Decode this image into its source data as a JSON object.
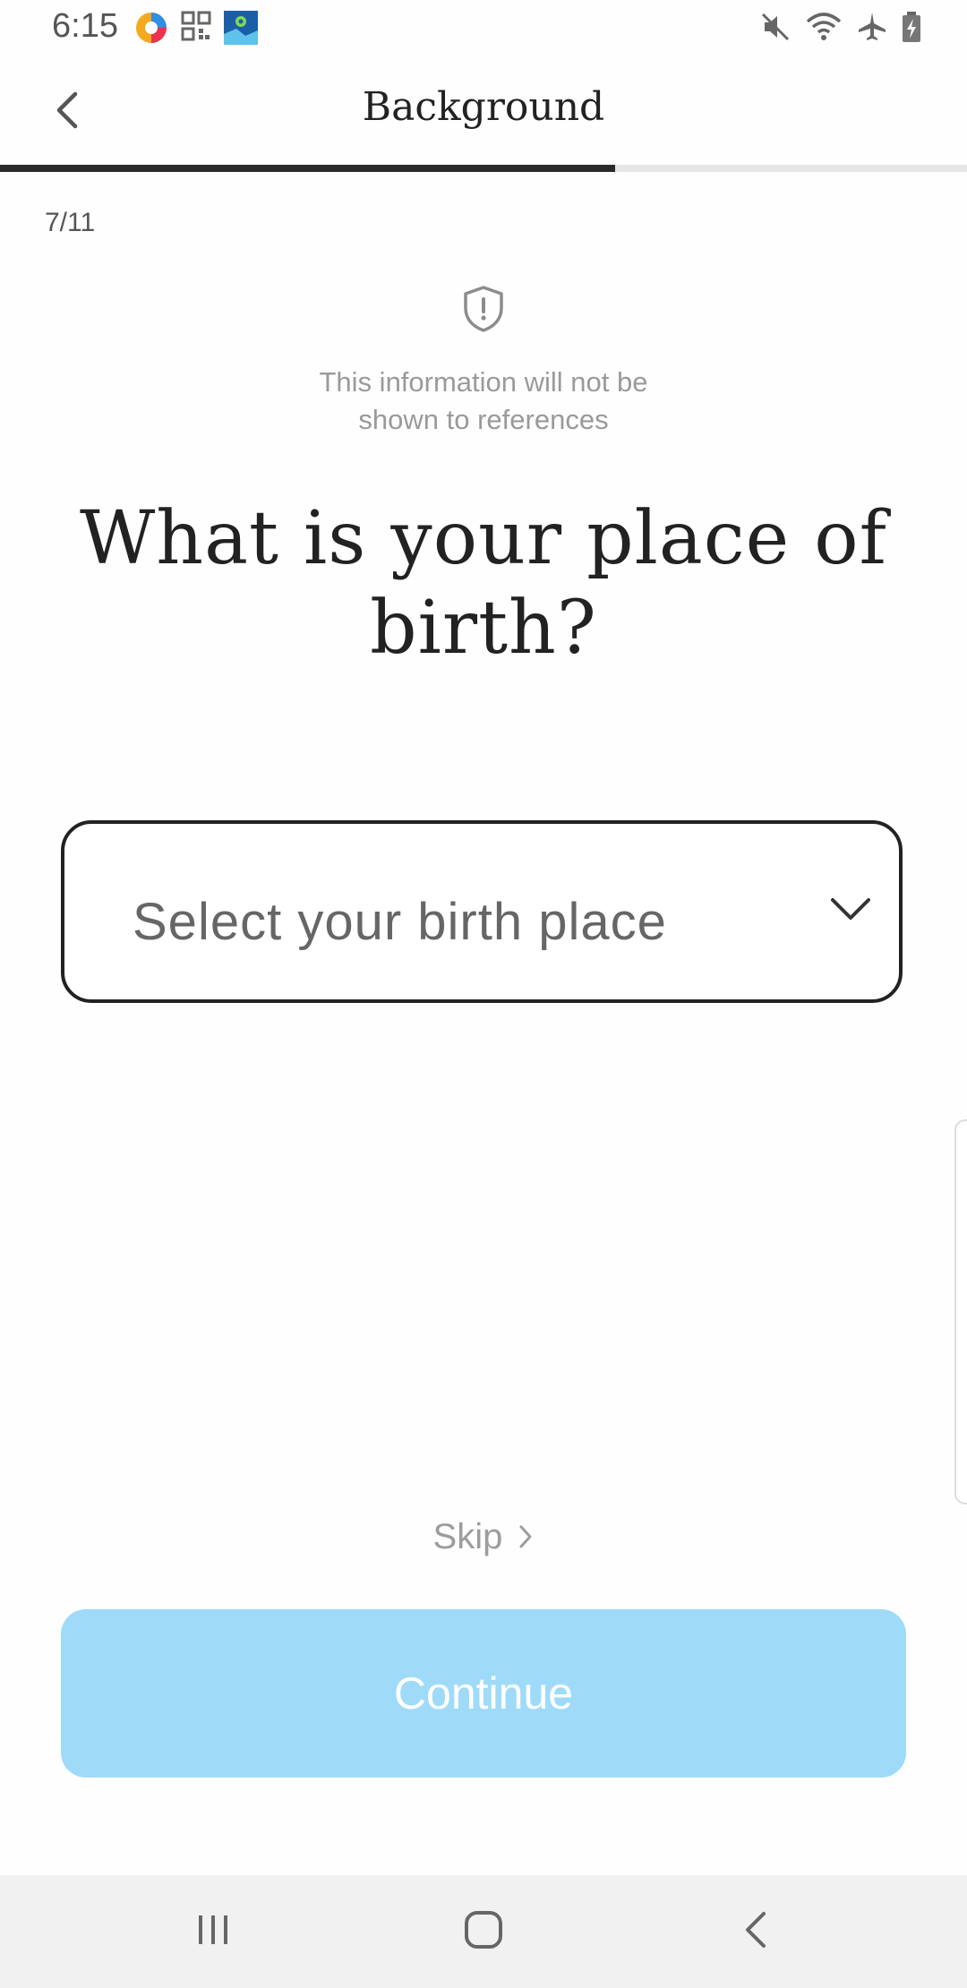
{
  "status_bar": {
    "time": "6:15",
    "left_icons": [
      "browser-app-icon",
      "qr-code-icon",
      "maps-app-icon"
    ],
    "right_icons": [
      "mute-icon",
      "wifi-icon",
      "airplane-mode-icon",
      "battery-charging-icon"
    ]
  },
  "header": {
    "title": "Background",
    "back_icon": "chevron-left-icon",
    "progress_fraction": 0.636
  },
  "step": {
    "counter": "7/11"
  },
  "privacy": {
    "icon": "shield-alert-icon",
    "line1": "This information will not be",
    "line2": "shown to references"
  },
  "question": {
    "line1": "What is your place of",
    "line2": "birth?"
  },
  "birth_place_select": {
    "placeholder": "Select your birth place",
    "icon": "chevron-down-icon"
  },
  "skip": {
    "label": "Skip",
    "icon": "chevron-right-icon"
  },
  "continue_button": {
    "label": "Continue",
    "color": "#9fdbf9"
  },
  "nav_bar": {
    "recents_icon": "recents-icon",
    "home_icon": "home-icon",
    "back_icon": "back-icon"
  }
}
